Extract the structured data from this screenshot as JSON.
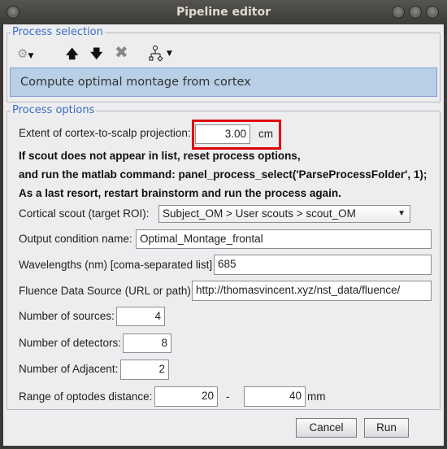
{
  "window": {
    "title": "Pipeline editor"
  },
  "process_selection": {
    "legend": "Process selection",
    "selected_process": "Compute optimal montage from cortex",
    "toolbar": {
      "add": "gear-icon",
      "move_up": "arrow-up-icon",
      "move_down": "arrow-down-icon",
      "delete": "delete-x-icon",
      "pipeline": "tree-icon"
    }
  },
  "process_options": {
    "legend": "Process options",
    "projection": {
      "label": "Extent of cortex-to-scalp projection:",
      "value": "3.00",
      "unit": "cm",
      "highlight_color": "#e00000"
    },
    "notes": [
      "If scout does not appear in list, reset process options,",
      "and run the matlab command: panel_process_select('ParseProcessFolder', 1);",
      "As a last resort, restart brainstorm and run the process again."
    ],
    "scout": {
      "label": "Cortical scout (target ROI):",
      "value": "Subject_OM > User scouts > scout_OM"
    },
    "condition": {
      "label": "Output condition name:",
      "value": "Optimal_Montage_frontal"
    },
    "wavelengths": {
      "label": "Wavelengths (nm) [coma-separated list]",
      "value": "685"
    },
    "fluence": {
      "label": "Fluence Data Source (URL or path)",
      "value": "http://thomasvincent.xyz/nst_data/fluence/"
    },
    "sources": {
      "label": "Number of sources:",
      "value": "4"
    },
    "detectors": {
      "label": "Number of detectors:",
      "value": "8"
    },
    "adjacent": {
      "label": "Number of Adjacent:",
      "value": "2"
    },
    "range": {
      "label": "Range of optodes distance:",
      "min": "20",
      "sep": "-",
      "max": "40",
      "unit": "mm"
    }
  },
  "buttons": {
    "cancel": "Cancel",
    "run": "Run"
  }
}
